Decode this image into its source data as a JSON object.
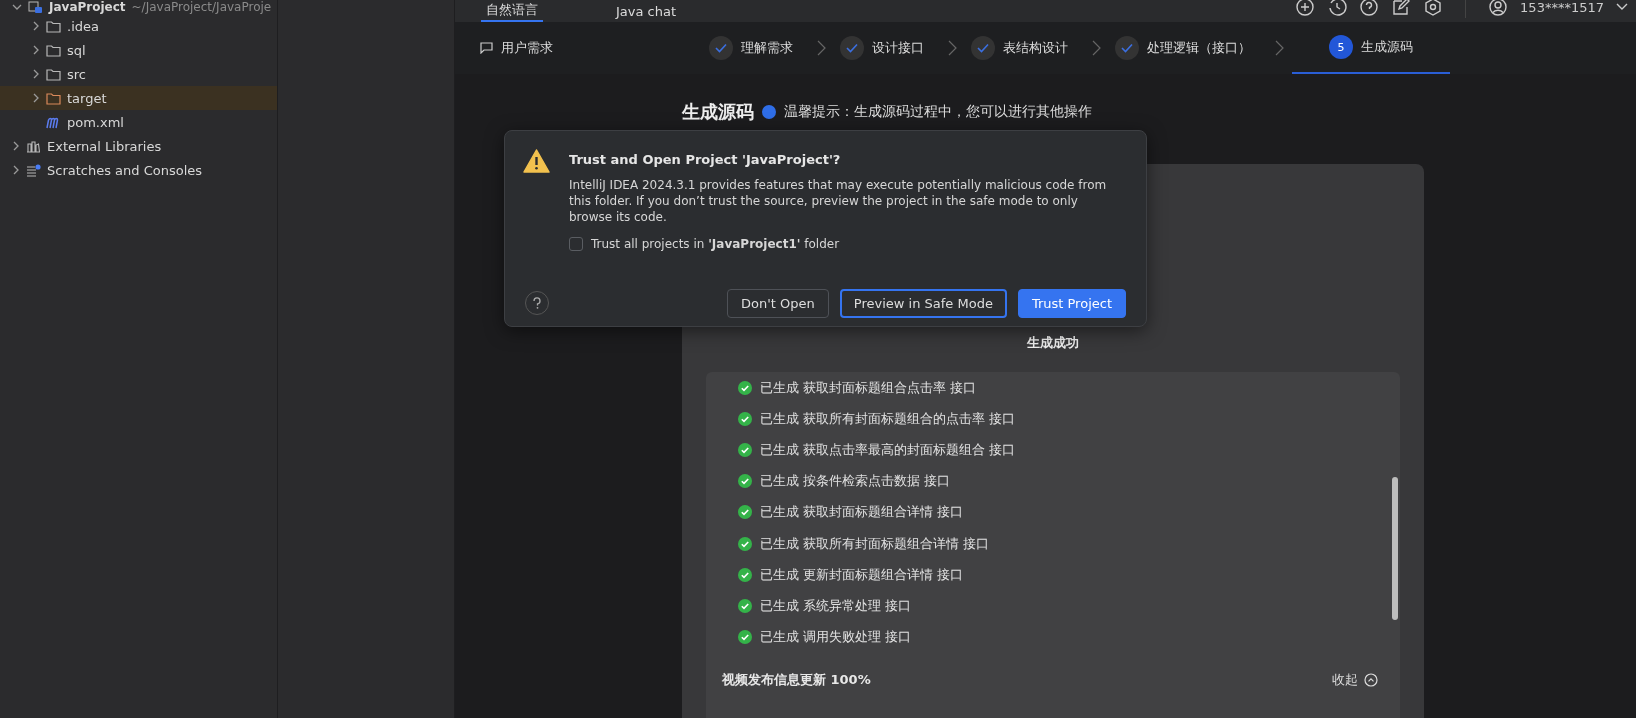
{
  "project_tree": {
    "root": {
      "name": "JavaProject",
      "path": "~/JavaProject/JavaProje",
      "expanded": true,
      "children": [
        {
          "name": ".idea",
          "kind": "folder",
          "selected": false
        },
        {
          "name": "sql",
          "kind": "folder",
          "selected": false
        },
        {
          "name": "src",
          "kind": "folder",
          "selected": false
        },
        {
          "name": "target",
          "kind": "excluded",
          "selected": true
        },
        {
          "name": "pom.xml",
          "kind": "maven",
          "selected": false
        }
      ]
    },
    "others": [
      {
        "name": "External Libraries",
        "kind": "libraries"
      },
      {
        "name": "Scratches and Consoles",
        "kind": "scratches"
      }
    ]
  },
  "tabs": [
    {
      "label": "自然语言",
      "selected": true
    },
    {
      "label": "Java chat",
      "selected": false
    }
  ],
  "account": {
    "user": "153****1517"
  },
  "steps": {
    "requirement": "用户需求",
    "items": [
      {
        "label": "理解需求",
        "done": true,
        "selected": false
      },
      {
        "label": "设计接口",
        "done": true,
        "selected": false
      },
      {
        "label": "表结构设计",
        "done": true,
        "selected": false
      },
      {
        "label": "处理逻辑（接口）",
        "done": true,
        "selected": false
      },
      {
        "number": "5",
        "label": "生成源码",
        "done": false,
        "selected": true
      }
    ]
  },
  "content": {
    "title": "生成源码",
    "hint": "温馨提示：生成源码过程中，您可以进行其他操作",
    "status": "生成成功",
    "items": [
      {
        "text": "已生成 获取封面标题组合点击率 接口",
        "done": true
      },
      {
        "text": "已生成 获取所有封面标题组合的点击率 接口",
        "done": true
      },
      {
        "text": "已生成 获取点击率最高的封面标题组合 接口",
        "done": true
      },
      {
        "text": "已生成 按条件检索点击数据 接口",
        "done": true
      },
      {
        "text": "已生成 获取封面标题组合详情 接口",
        "done": true
      },
      {
        "text": "已生成 获取所有封面标题组合详情 接口",
        "done": true
      },
      {
        "text": "已生成 更新封面标题组合详情 接口",
        "done": true
      },
      {
        "text": "已生成 系统异常处理 接口",
        "done": true
      },
      {
        "text": "已生成 调用失败处理 接口",
        "done": true
      }
    ],
    "group": {
      "title": "视频发布信息更新 100%",
      "toggle": "收起"
    }
  },
  "dialog": {
    "title": "Trust and Open Project 'JavaProject'?",
    "body": "IntelliJ IDEA 2024.3.1 provides features that may execute potentially malicious code from this folder. If you don’t trust the source, preview the project in the safe mode to only browse its code.",
    "checkbox": {
      "label": "Trust all projects in **'JavaProject1'** folder",
      "checked": false
    },
    "buttons": [
      {
        "label": "Don't Open",
        "kind": "plain"
      },
      {
        "label": "Preview in Safe Mode",
        "kind": "focused"
      },
      {
        "label": "Trust Project",
        "kind": "primary"
      }
    ]
  }
}
